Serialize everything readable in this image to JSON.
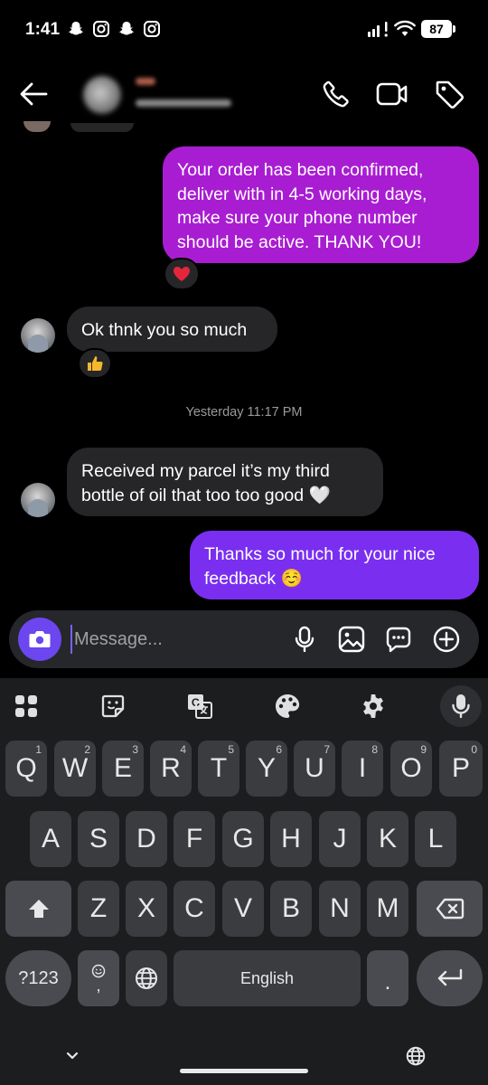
{
  "status_bar": {
    "time": "1:41",
    "battery": "87",
    "notification_icons": [
      "snapchat-icon",
      "instagram-icon",
      "snapchat-icon",
      "instagram-icon"
    ]
  },
  "header": {
    "icons": [
      "back-arrow-icon",
      "phone-icon",
      "video-icon",
      "tag-icon"
    ]
  },
  "messages": [
    {
      "direction": "outgoing",
      "lines": [
        "Your order has been confirmed,",
        "deliver with in 4-5 working days,",
        "make sure your phone number",
        "should be active. THANK YOU!"
      ],
      "reaction": "❤️"
    },
    {
      "direction": "incoming",
      "lines": [
        "Ok thnk you so much"
      ],
      "reaction": "👍"
    },
    {
      "direction": "incoming",
      "lines": [
        "Received my parcel it’s my third",
        "bottle of oil that too too good 🤍"
      ]
    },
    {
      "direction": "outgoing",
      "lines": [
        "Thanks so much for your nice",
        "feedback ☺️"
      ]
    }
  ],
  "timestamp": "Yesterday 11:17 PM",
  "composer": {
    "placeholder": "Message...",
    "icons": [
      "camera-icon",
      "microphone-icon",
      "gallery-icon",
      "sticker-icon",
      "add-icon"
    ],
    "accent": "#6c46ef"
  },
  "keyboard": {
    "toolbar": [
      "apps-grid-icon",
      "sticker-icon",
      "translate-icon",
      "palette-icon",
      "settings-icon",
      "microphone-icon"
    ],
    "row1": [
      "Q",
      "W",
      "E",
      "R",
      "T",
      "Y",
      "U",
      "I",
      "O",
      "P"
    ],
    "row1_hints": [
      "1",
      "2",
      "3",
      "4",
      "5",
      "6",
      "7",
      "8",
      "9",
      "0"
    ],
    "row2": [
      "A",
      "S",
      "D",
      "F",
      "G",
      "H",
      "J",
      "K",
      "L"
    ],
    "row3": [
      "Z",
      "X",
      "C",
      "V",
      "B",
      "N",
      "M"
    ],
    "symbols_key": "?123",
    "emoji_key_sub": ",",
    "space_label": "English",
    "period_key": ".",
    "bottom_icons": [
      "chevron-down-icon",
      "globe-icon"
    ]
  },
  "colors": {
    "outgoing_1": "#a91dd2",
    "outgoing_2": "#7a2ff0",
    "incoming": "#262629",
    "background": "#000000"
  }
}
